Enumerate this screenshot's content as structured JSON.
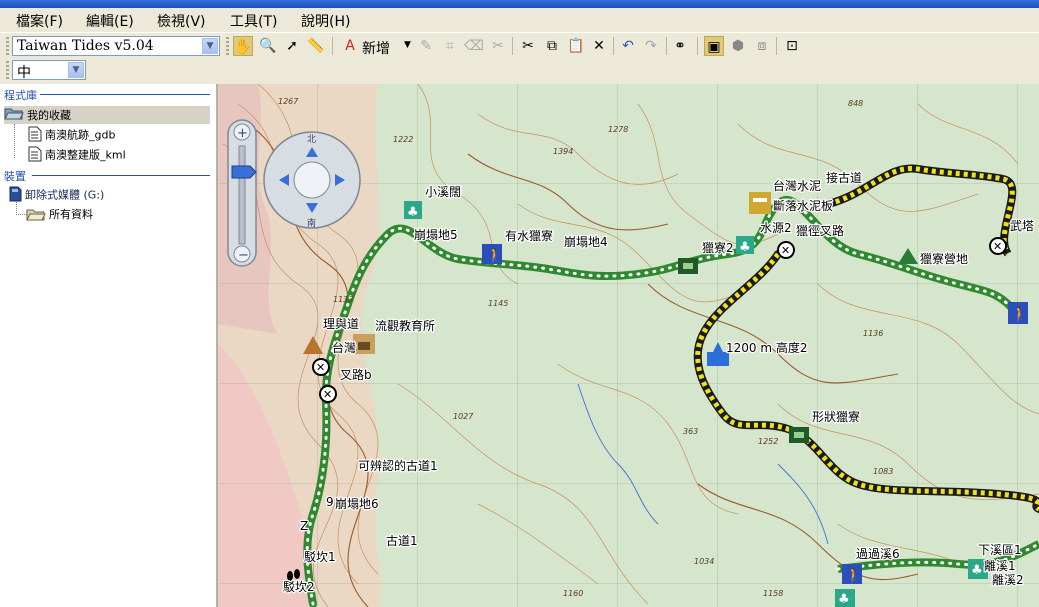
{
  "menu": [
    "檔案(F)",
    "編輯(E)",
    "檢視(V)",
    "工具(T)",
    "說明(H)"
  ],
  "toolbar": {
    "map_product": "Taiwan Tides v5.04",
    "new_label": "新增",
    "detail_level": "中"
  },
  "sidebar": {
    "library_heading": "程式庫",
    "favorites": "我的收藏",
    "files": [
      "南澳航跡_gdb",
      "南澳整建版_kml"
    ],
    "device_heading": "裝置",
    "device": "卸除式媒體 (G:)",
    "all_data": "所有資料"
  },
  "map": {
    "waypoints": [
      "小溪闊",
      "崩塌地5",
      "有水獵寮",
      "崩塌地4",
      "獵寮2",
      "水源2",
      "獵徑叉路",
      "斷落水泥板",
      "台灣水泥",
      "接古道",
      "獵寮營地",
      "武塔",
      "理與道",
      "台灣",
      "流觀教育所",
      "叉路b",
      "1200 m 高度2",
      "形狀獵寮",
      "可辨認的古道1",
      "崩塌地6",
      "古道1",
      "駁坎1",
      "駁坎2",
      "過過溪6",
      "下溪區1",
      "離溪1",
      "離溪2",
      "9",
      "Z"
    ],
    "contour_elevations": [
      "1267",
      "1222",
      "1278",
      "1394",
      "848",
      "1133",
      "1145",
      "1027",
      "1136",
      "363",
      "1252",
      "1083",
      "1034",
      "1160",
      "1158"
    ]
  },
  "colors": {
    "green_track": "#2f8a2f",
    "yellow_track": "#f0e21a",
    "contour": "#b07a4a",
    "relief_pink": "#e8b4b4"
  }
}
